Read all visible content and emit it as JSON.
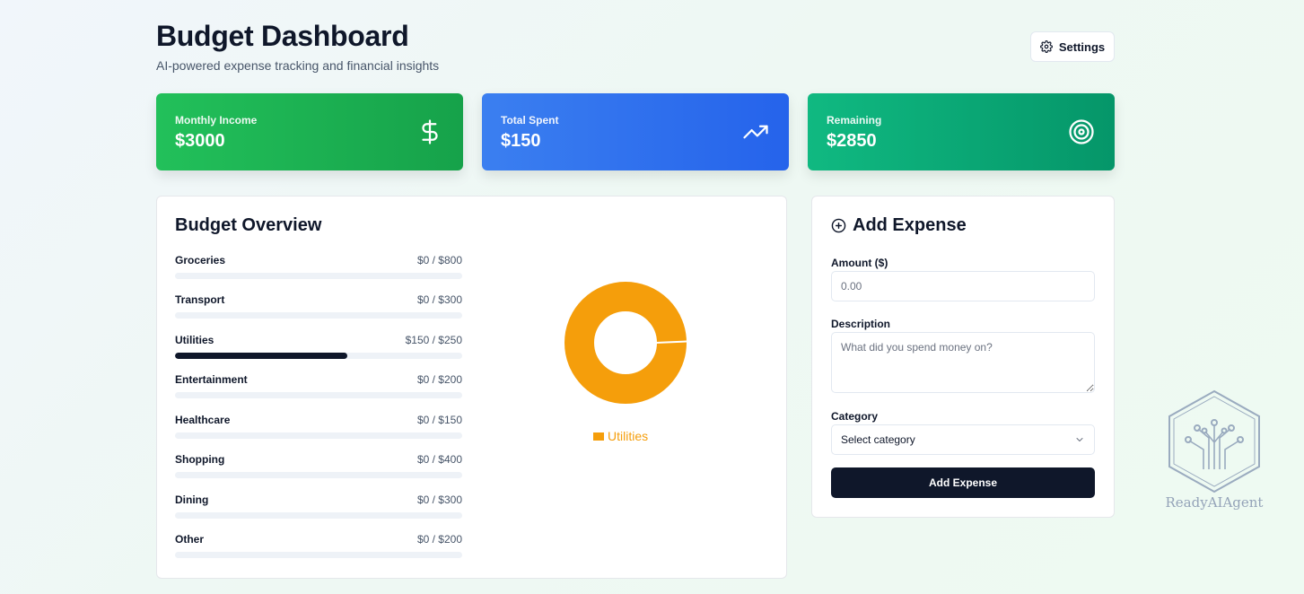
{
  "header": {
    "title": "Budget Dashboard",
    "subtitle": "AI-powered expense tracking and financial insights",
    "settings_label": "Settings",
    "settings_icon": "gear-icon"
  },
  "stats": [
    {
      "label": "Monthly Income",
      "value": "$3000",
      "icon": "dollar-icon",
      "color": "#1fb355"
    },
    {
      "label": "Total Spent",
      "value": "$150",
      "icon": "trending-up-icon",
      "color": "#3172ee"
    },
    {
      "label": "Remaining",
      "value": "$2850",
      "icon": "target-icon",
      "color": "#0ca678"
    }
  ],
  "overview": {
    "title": "Budget Overview",
    "categories": [
      {
        "name": "Groceries",
        "amount": "$0 / $800",
        "progress": 0
      },
      {
        "name": "Transport",
        "amount": "$0 / $300",
        "progress": 0
      },
      {
        "name": "Utilities",
        "amount": "$150 / $250",
        "progress": 0.6
      },
      {
        "name": "Entertainment",
        "amount": "$0 / $200",
        "progress": 0
      },
      {
        "name": "Healthcare",
        "amount": "$0 / $150",
        "progress": 0
      },
      {
        "name": "Shopping",
        "amount": "$0 / $400",
        "progress": 0
      },
      {
        "name": "Dining",
        "amount": "$0 / $300",
        "progress": 0
      },
      {
        "name": "Other",
        "amount": "$0 / $200",
        "progress": 0
      }
    ],
    "chart_data": {
      "type": "pie",
      "categories": [
        "Utilities"
      ],
      "values": [
        150
      ],
      "colors": [
        "#f59e0b"
      ],
      "legend": "bottom"
    }
  },
  "add_expense": {
    "title": "Add Expense",
    "title_icon": "plus-circle-icon",
    "amount_label": "Amount ($)",
    "amount_placeholder": "0.00",
    "description_label": "Description",
    "description_placeholder": "What did you spend money on?",
    "category_label": "Category",
    "category_value": "Select category",
    "submit_label": "Add Expense"
  },
  "watermark": {
    "text": "ReadyAIAgent"
  }
}
